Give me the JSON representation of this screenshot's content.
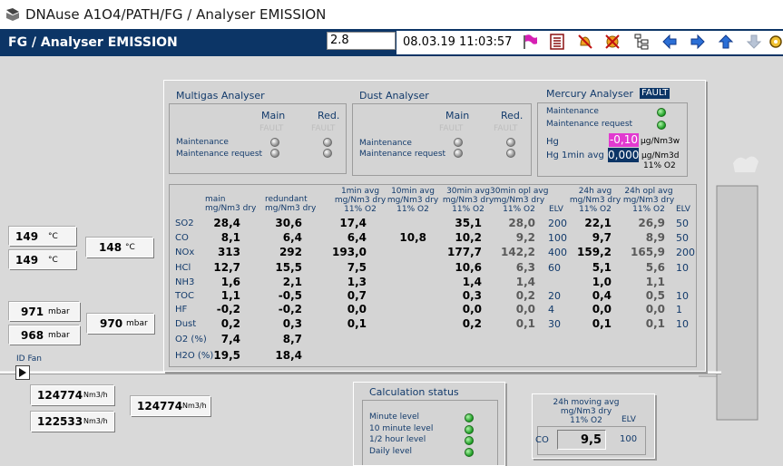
{
  "window": {
    "title": "DNAuse A1O4/PATH/FG / Analyser EMISSION"
  },
  "header": {
    "page_title": "FG / Analyser EMISSION",
    "input_value": "2.8",
    "datetime": "08.03.19 11:03:57"
  },
  "toolbar": {
    "icons": [
      "flag-icon",
      "report-icon",
      "alarm-mute-icon",
      "alarm-ack-icon",
      "hierarchy-icon",
      "arrow-left-icon",
      "arrow-right-icon",
      "arrow-up-icon",
      "arrow-down-icon",
      "settings-icon"
    ],
    "flag_color": "#d61fb3",
    "report_color": "#8b1010"
  },
  "multigas": {
    "title": "Multigas Analyser",
    "col_main": "Main",
    "col_red": "Red.",
    "fault_main": "FAULT",
    "fault_red": "FAULT",
    "rows": [
      "Maintenance",
      "Maintenance request"
    ]
  },
  "dust": {
    "title": "Dust Analyser",
    "col_main": "Main",
    "col_red": "Red.",
    "fault_main": "FAULT",
    "fault_red": "FAULT",
    "rows": [
      "Maintenance",
      "Maintenance request"
    ]
  },
  "mercury": {
    "title": "Mercury Analyser",
    "fault": "FAULT",
    "rows": [
      "Maintenance",
      "Maintenance request"
    ],
    "hg_label": "Hg",
    "hg_value": "-0,10",
    "hg_unit": "µg/Nm3w",
    "hg1_label": "Hg 1min avg",
    "hg1_value": "0,000",
    "hg1_unit": "µg/Nm3d",
    "hg1_unit2": "11% O2",
    "hg_value_color": "#e23ad0"
  },
  "table": {
    "headers": {
      "main": [
        "main",
        "mg/Nm3 dry"
      ],
      "redundant": [
        "redundant",
        "mg/Nm3 dry"
      ],
      "avg1": [
        "1min avg",
        "mg/Nm3 dry",
        "11% O2"
      ],
      "avg10": [
        "10min avg",
        "mg/Nm3 dry",
        "11% O2"
      ],
      "avg30": [
        "30min avg",
        "mg/Nm3 dry",
        "11% O2"
      ],
      "opl30": [
        "30min opl avg",
        "mg/Nm3 dry",
        "11% O2"
      ],
      "elv": "ELV",
      "avg24": [
        "24h avg",
        "mg/Nm3 dry",
        "11% O2"
      ],
      "opl24": [
        "24h opl avg",
        "mg/Nm3 dry",
        "11% O2"
      ],
      "elv24": "ELV"
    },
    "rows": [
      {
        "name": "SO2",
        "main": "28,4",
        "red": "30,6",
        "a1": "17,4",
        "a10": "",
        "a30": "35,1",
        "o30": "28,0",
        "elv": "200",
        "a24": "22,1",
        "o24": "26,9",
        "elv24": "50"
      },
      {
        "name": "CO",
        "main": "8,1",
        "red": "6,4",
        "a1": "6,4",
        "a10": "10,8",
        "a30": "10,2",
        "o30": "9,2",
        "elv": "100",
        "a24": "9,7",
        "o24": "8,9",
        "elv24": "50"
      },
      {
        "name": "NOx",
        "main": "313",
        "red": "292",
        "a1": "193,0",
        "a10": "",
        "a30": "177,7",
        "o30": "142,2",
        "elv": "400",
        "a24": "159,2",
        "o24": "165,9",
        "elv24": "200"
      },
      {
        "name": "HCl",
        "main": "12,7",
        "red": "15,5",
        "a1": "7,5",
        "a10": "",
        "a30": "10,6",
        "o30": "6,3",
        "elv": "60",
        "a24": "5,1",
        "o24": "5,6",
        "elv24": "10"
      },
      {
        "name": "NH3",
        "main": "1,6",
        "red": "2,1",
        "a1": "1,3",
        "a10": "",
        "a30": "1,4",
        "o30": "1,4",
        "elv": "",
        "a24": "1,0",
        "o24": "1,1",
        "elv24": ""
      },
      {
        "name": "TOC",
        "main": "1,1",
        "red": "-0,5",
        "a1": "0,7",
        "a10": "",
        "a30": "0,3",
        "o30": "0,2",
        "elv": "20",
        "a24": "0,4",
        "o24": "0,5",
        "elv24": "10"
      },
      {
        "name": "HF",
        "main": "-0,2",
        "red": "-0,2",
        "a1": "0,0",
        "a10": "",
        "a30": "0,0",
        "o30": "0,0",
        "elv": "4",
        "a24": "0,0",
        "o24": "0,0",
        "elv24": "1"
      },
      {
        "name": "Dust",
        "main": "0,2",
        "red": "0,3",
        "a1": "0,1",
        "a10": "",
        "a30": "0,2",
        "o30": "0,1",
        "elv": "30",
        "a24": "0,1",
        "o24": "0,1",
        "elv24": "10"
      },
      {
        "name": "O2 (%)",
        "main": "7,4",
        "red": "8,7",
        "a1": "",
        "a10": "",
        "a30": "",
        "o30": "",
        "elv": "",
        "a24": "",
        "o24": "",
        "elv24": ""
      },
      {
        "name": "H2O (%)",
        "main": "19,5",
        "red": "18,4",
        "a1": "",
        "a10": "",
        "a30": "",
        "o30": "",
        "elv": "",
        "a24": "",
        "o24": "",
        "elv24": ""
      }
    ]
  },
  "temps": {
    "t1": "149",
    "t2": "149",
    "t_avg": "148",
    "unit": "°C"
  },
  "pressures": {
    "p1": "971",
    "p2": "968",
    "p_avg": "970",
    "unit": "mbar"
  },
  "flows": {
    "f1": "124774",
    "f2": "122533",
    "f_avg": "124774",
    "unit": "Nm3/h"
  },
  "fan": {
    "label": "ID Fan"
  },
  "calc_status": {
    "title": "Calculation status",
    "rows": [
      "Minute level",
      "10 minute level",
      "1/2 hour level",
      "Daily level"
    ]
  },
  "moving_avg": {
    "title": [
      "24h moving avg",
      "mg/Nm3 dry",
      "11% O2"
    ],
    "elv_label": "ELV",
    "row_label": "CO",
    "value": "9,5",
    "elv": "100"
  }
}
